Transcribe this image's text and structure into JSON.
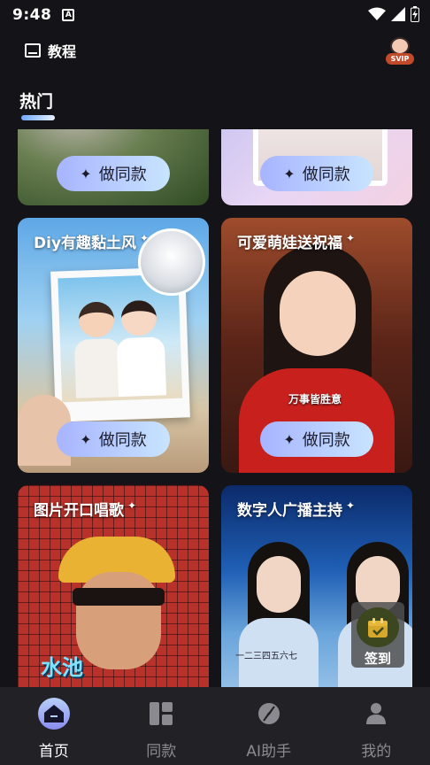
{
  "status_bar": {
    "time": "9:48",
    "sim_label": "A"
  },
  "header": {
    "tutorial_label": "教程",
    "vip_badge": "SVIP"
  },
  "section": {
    "title": "热门"
  },
  "cards": [
    {
      "title": "",
      "button": "做同款",
      "icon": "hedge-photo"
    },
    {
      "title": "",
      "button": "做同款",
      "icon": "white-frame-photo"
    },
    {
      "title": "Diy有趣黏土风",
      "button": "做同款",
      "icon": "clay-wedding-photo"
    },
    {
      "title": "可爱萌娃送祝福",
      "button": "做同款",
      "icon": "girl-greeting-photo",
      "overlay_text": "万事皆胜意"
    },
    {
      "title": "图片开口唱歌",
      "button": "",
      "icon": "pixel-singer-photo",
      "overlay_text": "水池"
    },
    {
      "title": "数字人广播主持",
      "button": "",
      "icon": "news-anchor-photo",
      "overlay_text": "一二三四五六七"
    }
  ],
  "floating": {
    "checkin_label": "签到",
    "checkin_icon": "calendar-check-icon",
    "accent": "#d6a82a"
  },
  "bottom_nav": [
    {
      "label": "首页",
      "icon": "home-icon",
      "active": true
    },
    {
      "label": "同款",
      "icon": "layout-icon",
      "active": false
    },
    {
      "label": "AI助手",
      "icon": "compass-icon",
      "active": false
    },
    {
      "label": "我的",
      "icon": "profile-icon",
      "active": false
    }
  ],
  "colors": {
    "background": "#141418",
    "nav_background": "#222226",
    "button_gradient_start": "#a7b4ff",
    "button_gradient_end": "#c8e4ff",
    "inactive_nav": "#8a8a90"
  }
}
